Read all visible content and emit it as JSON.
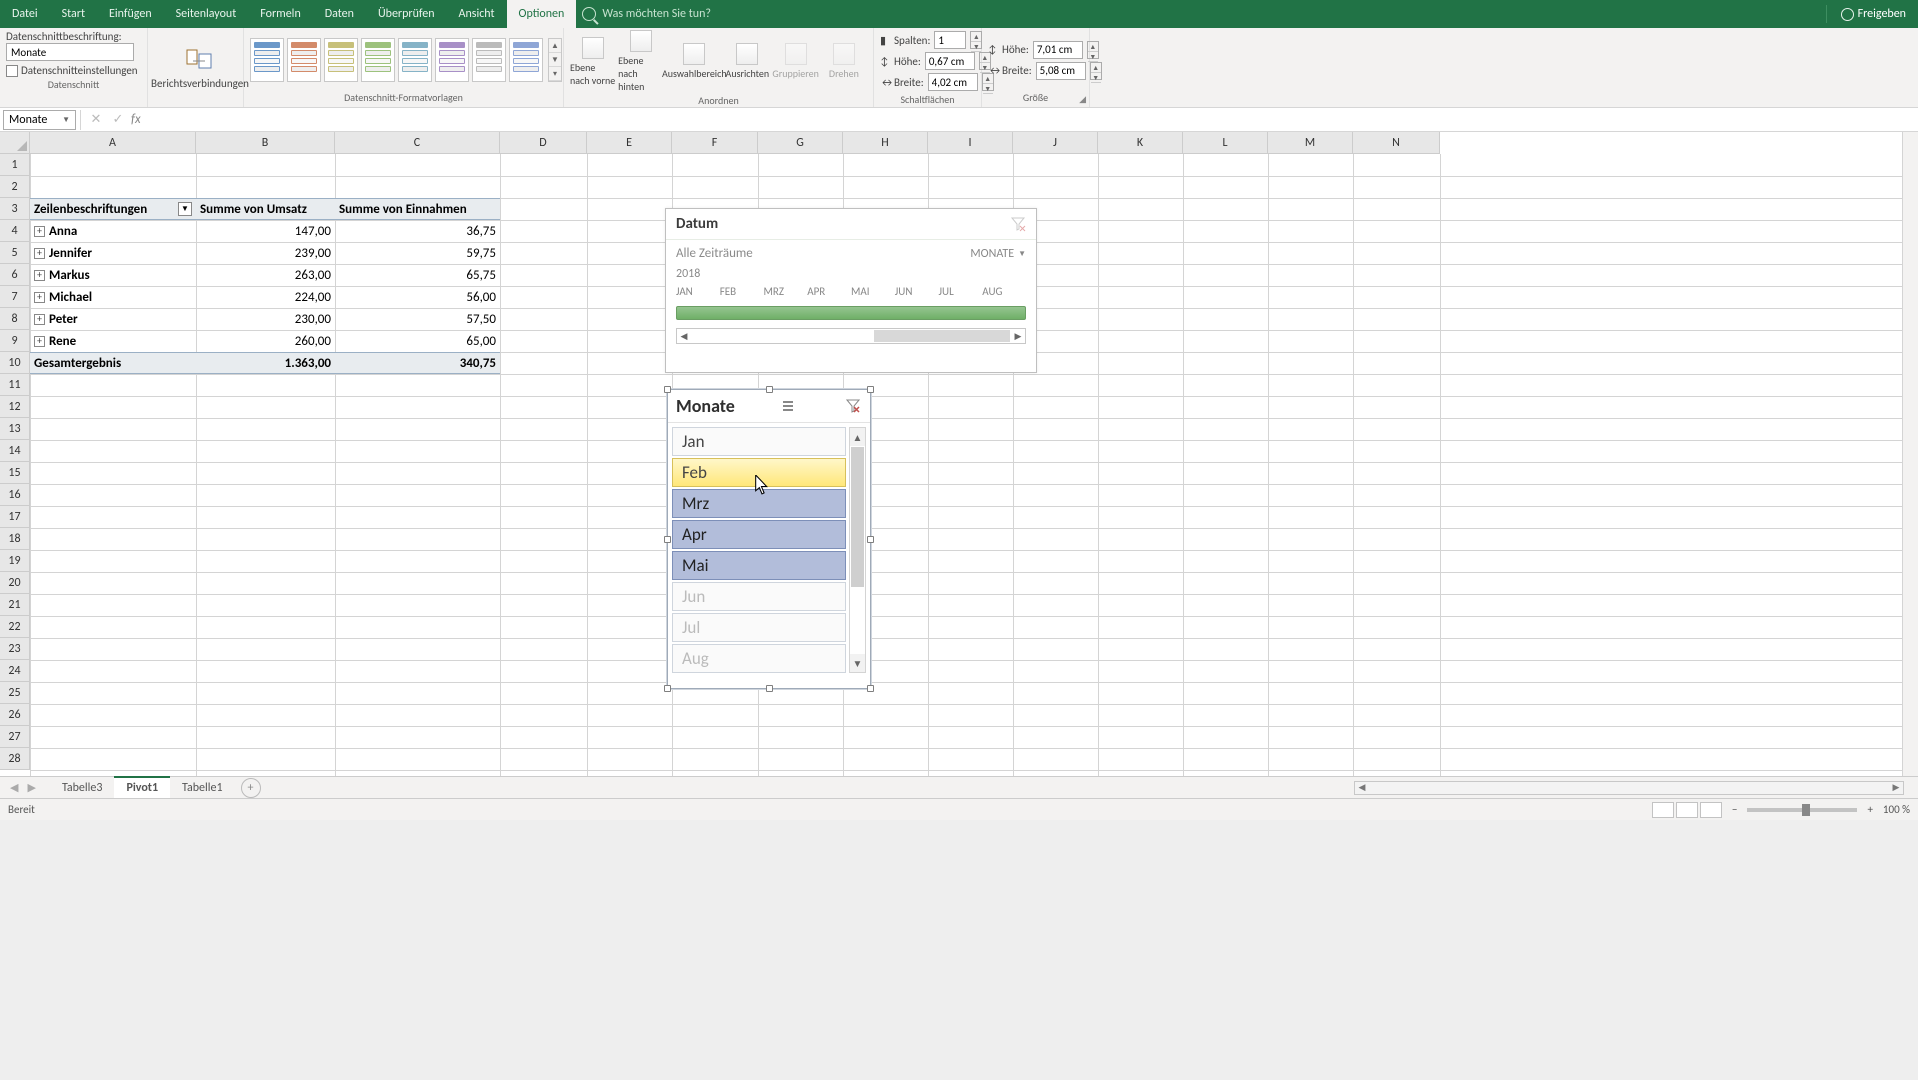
{
  "titlebar": {
    "items": [
      "Datei",
      "Start",
      "Einfügen",
      "Seitenlayout",
      "Formeln",
      "Daten",
      "Überprüfen",
      "Ansicht",
      "Optionen"
    ],
    "active_index": 8,
    "search_placeholder": "Was möchten Sie tun?",
    "share": "Freigeben"
  },
  "ribbon": {
    "caption_label": "Datenschnittbeschriftung:",
    "caption_value": "Monate",
    "slicer_settings": "Datenschnitteinstellungen",
    "group_slicer": "Datenschnitt",
    "report_conn": "Berichtsverbindungen",
    "group_styles": "Datenschnitt-Formatvorlagen",
    "arrange": {
      "bring_forward": "Ebene nach vorne",
      "send_backward": "Ebene nach hinten",
      "selection_pane": "Auswahlbereich",
      "align": "Ausrichten",
      "group": "Gruppieren",
      "rotate": "Drehen",
      "label": "Anordnen"
    },
    "buttons": {
      "cols_label": "Spalten:",
      "cols_val": "1",
      "h_label": "Höhe:",
      "h_val": "0,67 cm",
      "w_label": "Breite:",
      "w_val": "4,02 cm",
      "label": "Schaltflächen"
    },
    "size": {
      "h_label": "Höhe:",
      "h_val": "7,01 cm",
      "w_label": "Breite:",
      "w_val": "5,08 cm",
      "label": "Größe"
    }
  },
  "namebox": "Monate",
  "columns": [
    "A",
    "B",
    "C",
    "D",
    "E",
    "F",
    "G",
    "H",
    "I",
    "J",
    "K",
    "L",
    "M",
    "N"
  ],
  "col_edges": [
    30,
    196,
    335,
    500,
    587,
    672,
    758,
    843,
    928,
    1013,
    1098,
    1183,
    1268,
    1353,
    1440
  ],
  "row_count": 28,
  "pivot": {
    "h1": "Zeilenbeschriftungen",
    "h2": "Summe von Umsatz",
    "h3": "Summe von Einnahmen",
    "rows": [
      {
        "name": "Anna",
        "v1": "147,00",
        "v2": "36,75"
      },
      {
        "name": "Jennifer",
        "v1": "239,00",
        "v2": "59,75"
      },
      {
        "name": "Markus",
        "v1": "263,00",
        "v2": "65,75"
      },
      {
        "name": "Michael",
        "v1": "224,00",
        "v2": "56,00"
      },
      {
        "name": "Peter",
        "v1": "230,00",
        "v2": "57,50"
      },
      {
        "name": "Rene",
        "v1": "260,00",
        "v2": "65,00"
      }
    ],
    "total_label": "Gesamtergebnis",
    "total_v1": "1.363,00",
    "total_v2": "340,75"
  },
  "timeline": {
    "title": "Datum",
    "period": "Alle Zeiträume",
    "level": "MONATE",
    "year": "2018",
    "months": [
      "JAN",
      "FEB",
      "MRZ",
      "APR",
      "MAI",
      "JUN",
      "JUL",
      "AUG"
    ]
  },
  "slicer": {
    "title": "Monate",
    "items": [
      {
        "t": "Jan",
        "state": "normal"
      },
      {
        "t": "Feb",
        "state": "hover"
      },
      {
        "t": "Mrz",
        "state": "selected"
      },
      {
        "t": "Apr",
        "state": "selected"
      },
      {
        "t": "Mai",
        "state": "selected"
      },
      {
        "t": "Jun",
        "state": "muted"
      },
      {
        "t": "Jul",
        "state": "muted"
      },
      {
        "t": "Aug",
        "state": "muted"
      }
    ]
  },
  "tabs": {
    "items": [
      "Tabelle3",
      "Pivot1",
      "Tabelle1"
    ],
    "active": 1
  },
  "status": "Bereit",
  "zoom": "100 %",
  "style_accents": [
    "#6b98c9",
    "#d38b6a",
    "#c7c07a",
    "#9dc27d",
    "#86b3c7",
    "#a890c7",
    "#bbbbbb",
    "#8fa6d6"
  ]
}
